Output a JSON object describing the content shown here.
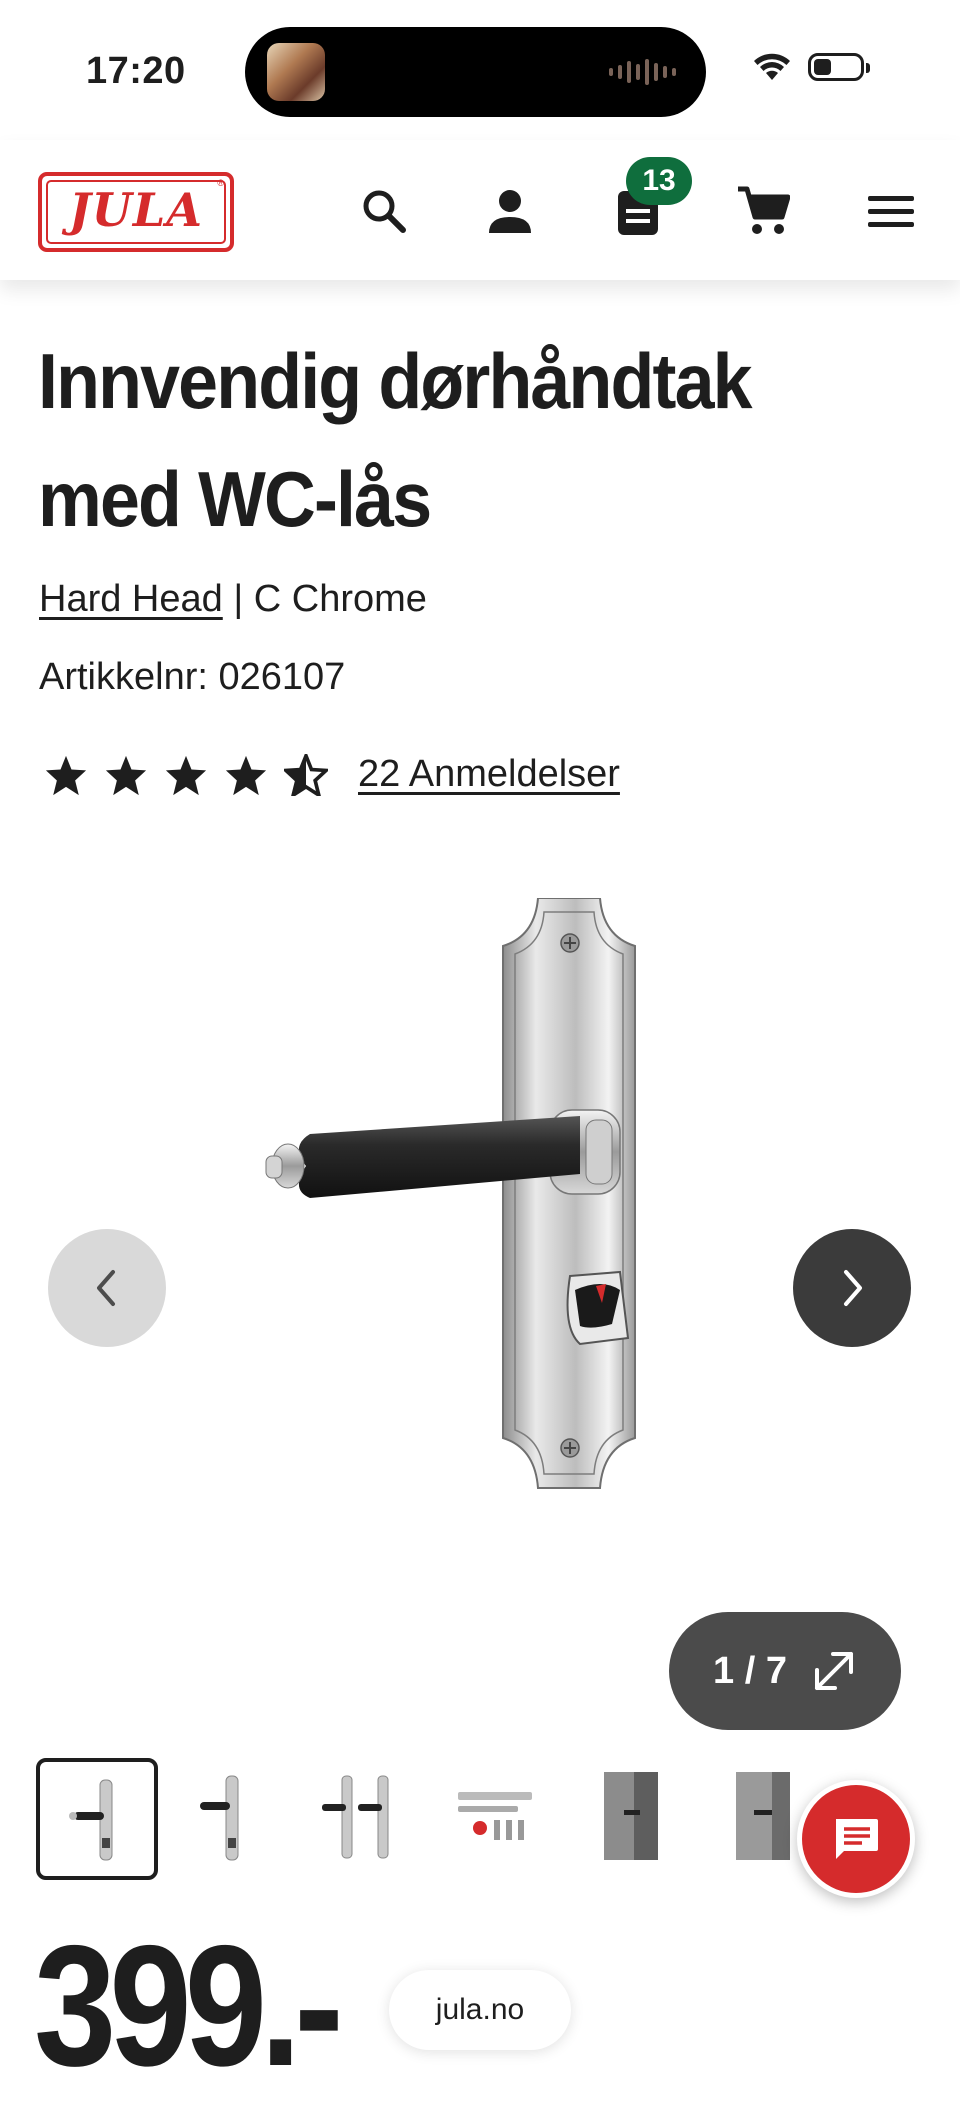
{
  "status_bar": {
    "time": "17:20",
    "battery_level": 0.3
  },
  "header": {
    "logo_text": "JULA",
    "cart_badge_count": "13",
    "icons": [
      "search-icon",
      "user-icon",
      "shopping-list-icon",
      "cart-icon",
      "menu-icon"
    ],
    "brand_color": "#d52b2c",
    "badge_color": "#0f6e3d"
  },
  "product": {
    "title": "Innvendig dørhåndtak med WC-lås",
    "brand": "Hard Head",
    "separator": "|",
    "variant": "C Chrome",
    "article_label": "Artikkelnr:",
    "article_number": "026107",
    "rating": 4.5,
    "reviews_label": "22 Anmeldelser"
  },
  "gallery": {
    "counter": "1 / 7",
    "current_index": 1,
    "total": 7,
    "thumbnails": 7
  },
  "price": {
    "value": "399.-"
  },
  "browser": {
    "url": "jula.no"
  }
}
